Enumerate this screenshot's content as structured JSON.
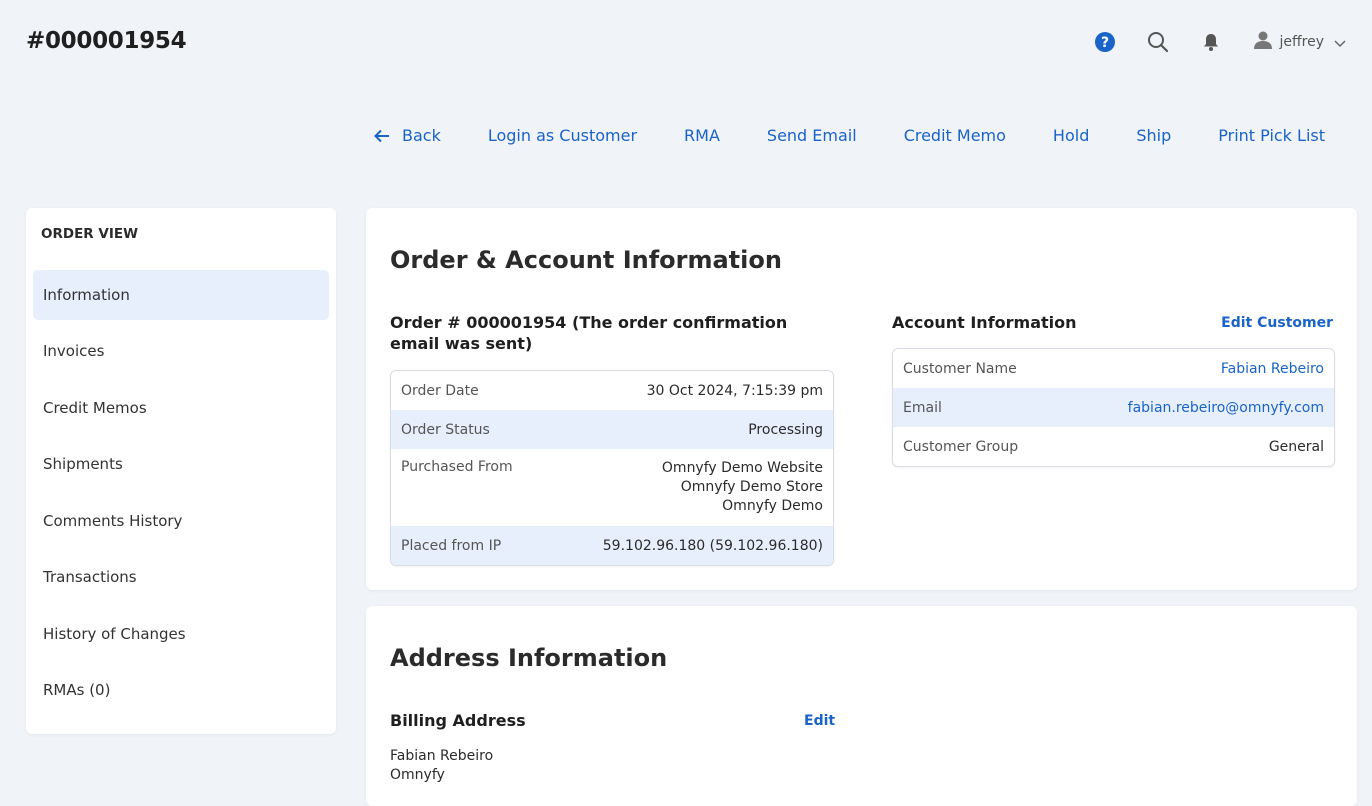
{
  "header": {
    "title": "#000001954",
    "username": "jeffrey"
  },
  "actions": {
    "back": "Back",
    "login_as_customer": "Login as Customer",
    "rma": "RMA",
    "send_email": "Send Email",
    "credit_memo": "Credit Memo",
    "hold": "Hold",
    "ship": "Ship",
    "print_pick_list": "Print Pick List"
  },
  "sidebar": {
    "title": "ORDER VIEW",
    "items": [
      {
        "label": "Information"
      },
      {
        "label": "Invoices"
      },
      {
        "label": "Credit Memos"
      },
      {
        "label": "Shipments"
      },
      {
        "label": "Comments History"
      },
      {
        "label": "Transactions"
      },
      {
        "label": "History of Changes"
      },
      {
        "label": "RMAs (0)"
      }
    ]
  },
  "order_account": {
    "title": "Order & Account Information",
    "order_heading": "Order # 000001954 (The order confirmation email was sent)",
    "order_rows": [
      {
        "key": "Order Date",
        "value": "30 Oct 2024, 7:15:39 pm"
      },
      {
        "key": "Order Status",
        "value": "Processing"
      },
      {
        "key": "Purchased From",
        "value_lines": [
          "Omnyfy Demo Website",
          "Omnyfy Demo Store",
          "Omnyfy Demo"
        ]
      },
      {
        "key": "Placed from IP",
        "value": "59.102.96.180 (59.102.96.180)"
      }
    ],
    "account_heading": "Account Information",
    "edit_customer": "Edit Customer",
    "account_rows": [
      {
        "key": "Customer Name",
        "value": "Fabian Rebeiro"
      },
      {
        "key": "Email",
        "value": "fabian.rebeiro@omnyfy.com"
      },
      {
        "key": "Customer Group",
        "value": "General"
      }
    ]
  },
  "address": {
    "title": "Address Information",
    "billing_heading": "Billing Address",
    "edit": "Edit",
    "billing_lines": [
      "Fabian Rebeiro",
      "Omnyfy"
    ]
  },
  "colors": {
    "accent": "#1a63c9",
    "background": "#f0f3f8",
    "row_highlight": "#e8effc"
  },
  "icons": [
    "help-icon",
    "search-icon",
    "bell-icon",
    "user-icon",
    "chevron-down-icon",
    "arrow-left-icon"
  ]
}
